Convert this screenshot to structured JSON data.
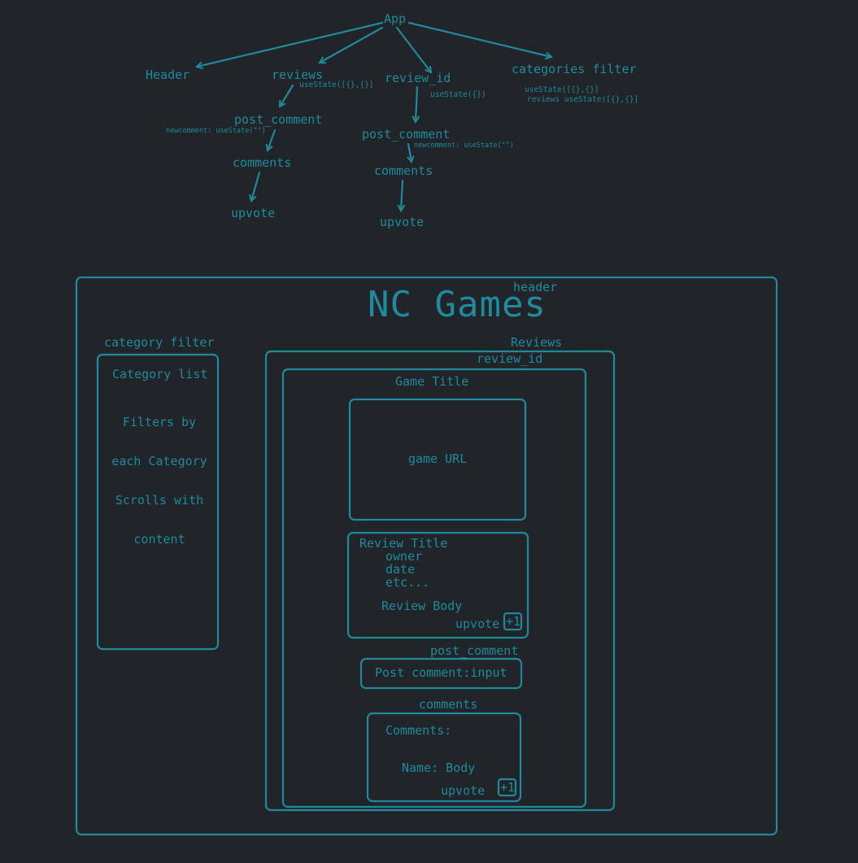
{
  "colors": {
    "background": "#212529",
    "ink": "#1e8a9c"
  },
  "tree": {
    "app": "App",
    "header": "Header",
    "reviews": "reviews",
    "reviews_state": "useState([{},{}]",
    "review_id": "review_id",
    "review_id_state": "useState({})",
    "categories_filter": "categories filter",
    "categories_state_1": "useState([{},{}]",
    "categories_state_2": "reviews useState([{},{}]",
    "left_post_comment": "post_comment",
    "left_newcomment": "newcomment: useState(\"\")",
    "left_comments": "comments",
    "left_upvote": "upvote",
    "right_post_comment": "post_comment",
    "right_newcomment": "newcomment: useState(\"\")",
    "right_comments": "comments",
    "right_upvote": "upvote"
  },
  "wireframe": {
    "header_label": "header",
    "title": "NC Games",
    "category_filter_label": "category filter",
    "category_list": "Category list",
    "filters_lines": [
      "Filters by",
      "each Category",
      "Scrolls with",
      "content"
    ],
    "reviews_label": "Reviews",
    "review_id_label": "review_id",
    "game_title": "Game Title",
    "game_url": "game URL",
    "review_title": "Review Title",
    "owner": "owner",
    "date": "date",
    "etc": "etc...",
    "review_body": "Review Body",
    "review_upvote": "upvote",
    "plus_one": "+1",
    "post_comment_label": "post_comment",
    "post_comment_input": "Post comment:input",
    "comments_label": "comments",
    "comments_heading": "Comments:",
    "name_body": "Name: Body",
    "comment_upvote": "upvote",
    "comment_plus_one": "+1"
  }
}
